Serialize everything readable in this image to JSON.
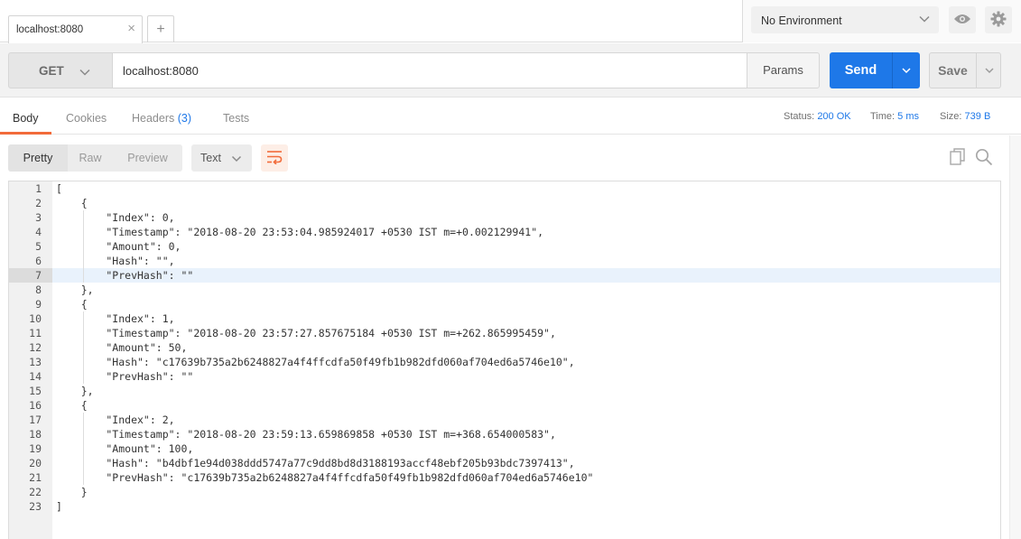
{
  "tabs": {
    "active_label": "localhost:8080",
    "close_glyph": "×",
    "new_tab_glyph": "+"
  },
  "environment": {
    "selected": "No Environment"
  },
  "request": {
    "method": "GET",
    "url": "localhost:8080",
    "params_label": "Params",
    "send_label": "Send",
    "save_label": "Save"
  },
  "response_tabs": {
    "body": "Body",
    "cookies": "Cookies",
    "headers": "Headers",
    "headers_count": "(3)",
    "tests": "Tests"
  },
  "status_bar": {
    "status_label": "Status:",
    "status_value": "200 OK",
    "time_label": "Time:",
    "time_value": "5 ms",
    "size_label": "Size:",
    "size_value": "739 B"
  },
  "view_toolbar": {
    "pretty": "Pretty",
    "raw": "Raw",
    "preview": "Preview",
    "format": "Text"
  },
  "colors": {
    "send_blue": "#1e78e8",
    "accent_orange": "#f26b3a"
  },
  "icons": [
    "chevron-down-icon",
    "eye-icon",
    "gear-icon",
    "wrap-lines-icon",
    "copy-icon",
    "search-icon"
  ],
  "body_lines": [
    "[",
    "    {",
    "        \"Index\": 0,",
    "        \"Timestamp\": \"2018-08-20 23:53:04.985924017 +0530 IST m=+0.002129941\",",
    "        \"Amount\": 0,",
    "        \"Hash\": \"\",",
    "        \"PrevHash\": \"\"",
    "    },",
    "    {",
    "        \"Index\": 1,",
    "        \"Timestamp\": \"2018-08-20 23:57:27.857675184 +0530 IST m=+262.865995459\",",
    "        \"Amount\": 50,",
    "        \"Hash\": \"c17639b735a2b6248827a4f4ffcdfa50f49fb1b982dfd060af704ed6a5746e10\",",
    "        \"PrevHash\": \"\"",
    "    },",
    "    {",
    "        \"Index\": 2,",
    "        \"Timestamp\": \"2018-08-20 23:59:13.659869858 +0530 IST m=+368.654000583\",",
    "        \"Amount\": 100,",
    "        \"Hash\": \"b4dbf1e94d038ddd5747a77c9dd8bd8d3188193accf48ebf205b93bdc7397413\",",
    "        \"PrevHash\": \"c17639b735a2b6248827a4f4ffcdfa50f49fb1b982dfd060af704ed6a5746e10\"",
    "    }",
    "]"
  ],
  "active_line": 7
}
